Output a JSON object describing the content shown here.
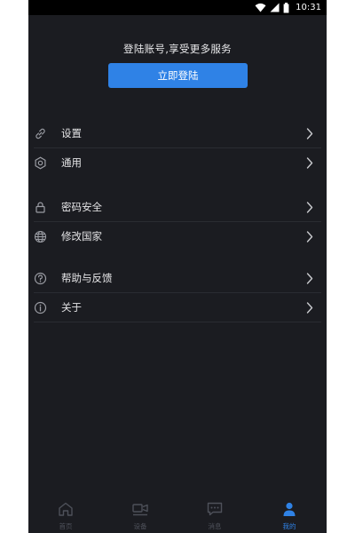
{
  "status_bar": {
    "time": "10:31",
    "icons": [
      "wifi-icon",
      "signal-icon",
      "battery-icon"
    ]
  },
  "header": {
    "login_prompt": "登陆账号,享受更多服务",
    "login_button": "立即登陆"
  },
  "menu": {
    "items": [
      {
        "label": "设置",
        "icon": "link-icon"
      },
      {
        "label": "通用",
        "icon": "gear-icon"
      },
      {
        "label": "密码安全",
        "icon": "lock-icon"
      },
      {
        "label": "修改国家",
        "icon": "globe-icon"
      },
      {
        "label": "帮助与反馈",
        "icon": "help-icon"
      },
      {
        "label": "关于",
        "icon": "info-icon"
      }
    ]
  },
  "tabbar": {
    "tabs": [
      {
        "label": "首页",
        "icon": "home-icon",
        "active": false
      },
      {
        "label": "设备",
        "icon": "device-icon",
        "active": false
      },
      {
        "label": "消息",
        "icon": "message-icon",
        "active": false
      },
      {
        "label": "我的",
        "icon": "person-icon",
        "active": true
      }
    ]
  },
  "colors": {
    "background": "#1b1c21",
    "accent": "#2f82e6",
    "text": "#e4e4e6",
    "inactive_tab": "#4e515a"
  }
}
